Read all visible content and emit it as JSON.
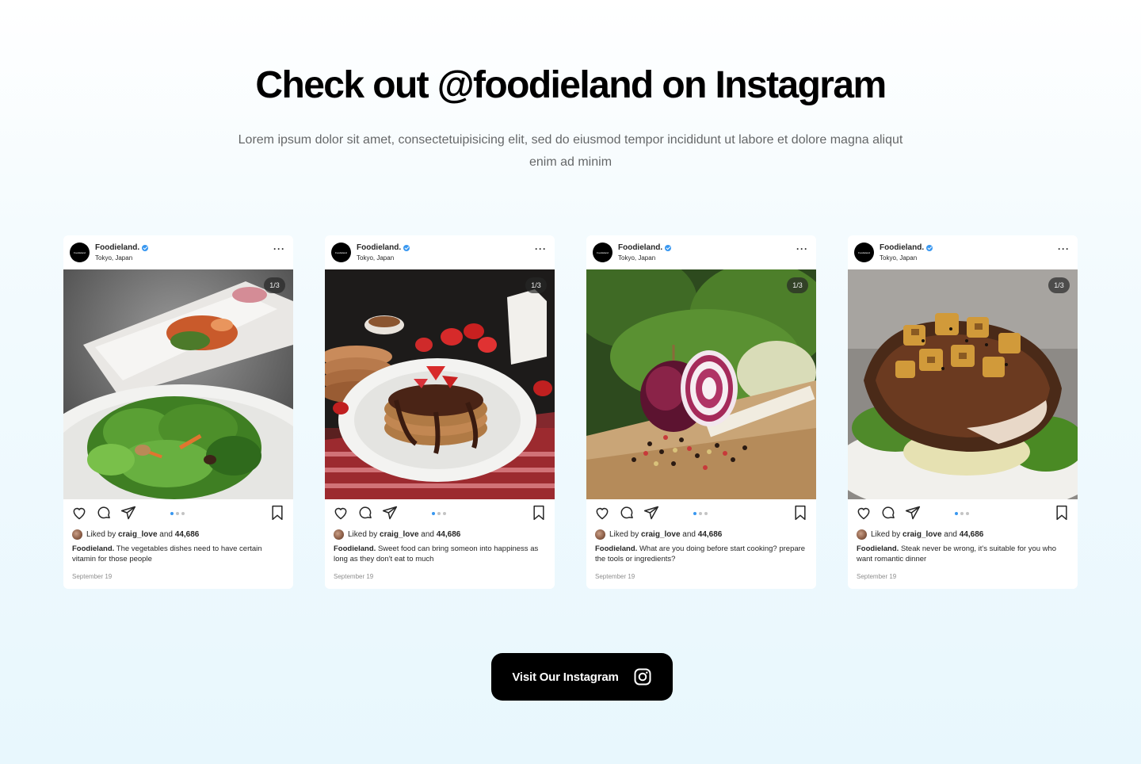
{
  "heading": "Check out @foodieland on Instagram",
  "subtitle": "Lorem ipsum dolor sit amet, consectetuipisicing elit, sed do eiusmod tempor incididunt ut labore et dolore magna aliqut enim ad minim",
  "cta": {
    "label": "Visit Our Instagram",
    "icon": "instagram-icon"
  },
  "posts": [
    {
      "username": "Foodieland.",
      "avatar_text": "Foodieland",
      "location": "Tokyo, Japan",
      "counter": "1/3",
      "liked_prefix": "Liked by",
      "liked_user": "craig_love",
      "liked_and": "and",
      "liked_count": "44,686",
      "caption_user": "Foodieland.",
      "caption_text": "The vegetables dishes need to have certain vitamin for those people",
      "date": "September 19"
    },
    {
      "username": "Foodieland.",
      "avatar_text": "Foodieland",
      "location": "Tokyo, Japan",
      "counter": "1/3",
      "liked_prefix": "Liked by",
      "liked_user": "craig_love",
      "liked_and": "and",
      "liked_count": "44,686",
      "caption_user": "Foodieland.",
      "caption_text": "Sweet food can bring someon into happiness as long as they don't eat to much",
      "date": "September 19"
    },
    {
      "username": "Foodieland.",
      "avatar_text": "Foodieland",
      "location": "Tokyo, Japan",
      "counter": "1/3",
      "liked_prefix": "Liked by",
      "liked_user": "craig_love",
      "liked_and": "and",
      "liked_count": "44,686",
      "caption_user": "Foodieland.",
      "caption_text": "What are you doing before start cooking? prepare the  tools or ingredients?",
      "date": "September 19"
    },
    {
      "username": "Foodieland.",
      "avatar_text": "Foodieland",
      "location": "Tokyo, Japan",
      "counter": "1/3",
      "liked_prefix": "Liked by",
      "liked_user": "craig_love",
      "liked_and": "and",
      "liked_count": "44,686",
      "caption_user": "Foodieland.",
      "caption_text": "Steak never be wrong, it's suitable for you who want romantic dinner",
      "date": "September 19"
    }
  ],
  "colors": {
    "accent": "#3897f0",
    "cta_bg": "#000000"
  }
}
